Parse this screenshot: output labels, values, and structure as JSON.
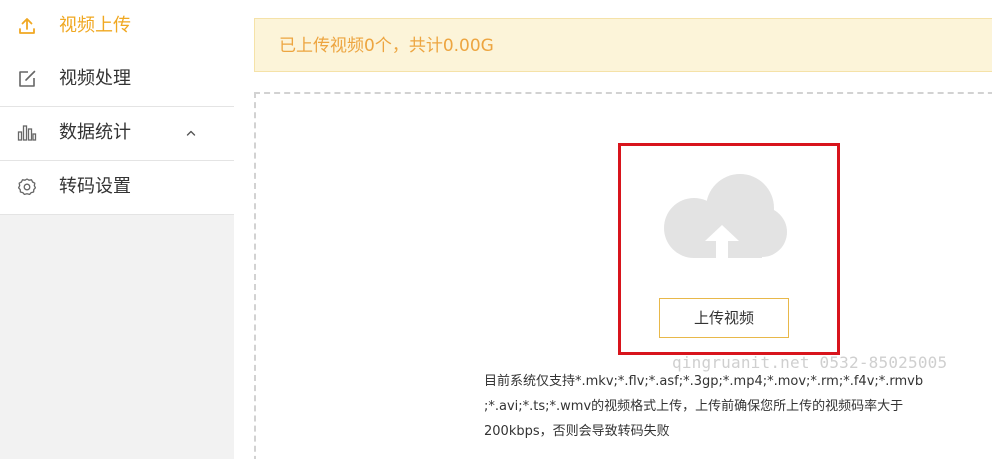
{
  "sidebar": {
    "items": [
      {
        "label": "视频上传",
        "icon": "upload-icon",
        "active": true
      },
      {
        "label": "视频处理",
        "icon": "edit-icon",
        "active": false
      },
      {
        "label": "数据统计",
        "icon": "bar-chart-icon",
        "active": false,
        "expander": "chevron-up-icon"
      },
      {
        "label": "转码设置",
        "icon": "gear-icon",
        "active": false
      }
    ]
  },
  "notice": {
    "text": "已上传视频0个，共计0.00G"
  },
  "upload": {
    "icon": "cloud-upload-icon",
    "button_label": "上传视频",
    "hint_lines": [
      "目前系统仅支持*.mkv;*.flv;*.asf;*.3gp;*.mp4;*.mov;*.rm;*.f4v;*.rmvb",
      ";*.avi;*.ts;*.wmv的视频格式上传，上传前确保您所上传的视频码率大于",
      "200kbps，否则会导致转码失败"
    ]
  },
  "watermark": "qingruanit.net 0532-85025005",
  "colors": {
    "accent": "#f0a822",
    "notice_bg": "#fcf4d9",
    "notice_text": "#eda540",
    "highlight": "#d8141c",
    "cloud": "#e3e3e3"
  }
}
